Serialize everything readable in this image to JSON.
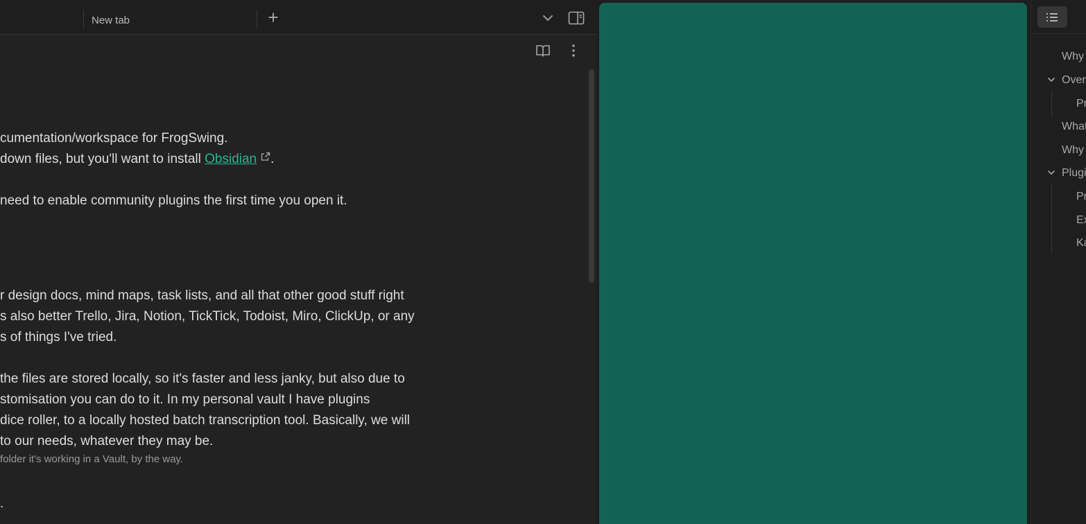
{
  "tabbar": {
    "tab_title": "New tab",
    "new_tab_glyph": "+",
    "tab_list_icon": "chevron-down-icon",
    "sidebar_icon": "sidebar-toggle-icon"
  },
  "view_header": {
    "reading_icon": "book-open-icon",
    "more_icon": "more-vertical-icon"
  },
  "editor": {
    "line1": "cumentation/workspace for FrogSwing.",
    "line2_pre": "down files, but you'll want to install ",
    "line2_link": "Obsidian",
    "line2_post": ".",
    "line3": " need to enable community plugins the first time you open it.",
    "line4": "r design docs, mind maps, task lists, and all that other good stuff right",
    "line5": "s also better Trello, Jira, Notion, TickTick, Todoist, Miro, ClickUp, or any",
    "line6": "s of things I've tried.",
    "line7": "the files are stored locally, so it's faster and less janky, but also due to",
    "line8": "stomisation you can do to it. In my personal vault I have plugins",
    "line9": "dice roller, to a locally hosted batch transcription tool. Basically, we will",
    "line10": "to our needs, whatever they may be.",
    "line11": "folder it's working in a Vault, by the way.",
    "line12": "."
  },
  "colors": {
    "panel_green": "#136354",
    "link": "#2bb58f"
  },
  "outline": {
    "icon": "list-icon",
    "items": [
      {
        "label": "Why"
      },
      {
        "label": "Over"
      },
      {
        "label": "Pr"
      },
      {
        "label": "What"
      },
      {
        "label": "Why"
      },
      {
        "label": "Plugi"
      },
      {
        "label": "Pr"
      },
      {
        "label": "Ex"
      },
      {
        "label": "Ka"
      }
    ]
  }
}
